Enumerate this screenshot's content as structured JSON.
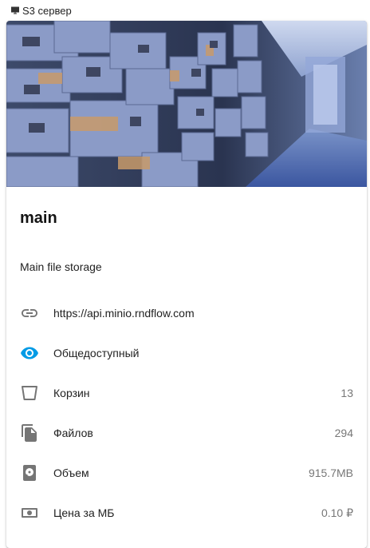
{
  "header": {
    "icon": "monitor-icon",
    "label": "S3 сервер"
  },
  "card": {
    "image": "file-cabinet-storage-photo",
    "title": "main",
    "description": "Main file storage",
    "accent_color": "#039be5",
    "rows": [
      {
        "icon": "link-icon",
        "label": "https://api.minio.rndflow.com",
        "value": ""
      },
      {
        "icon": "eye-icon",
        "label": "Общедоступный",
        "value": ""
      },
      {
        "icon": "bucket-icon",
        "label": "Корзин",
        "value": "13"
      },
      {
        "icon": "files-copy-icon",
        "label": "Файлов",
        "value": "294"
      },
      {
        "icon": "harddisk-icon",
        "label": "Объем",
        "value": "915.7MB"
      },
      {
        "icon": "cash-icon",
        "label": "Цена за МБ",
        "value": "0.10 ₽"
      }
    ]
  }
}
